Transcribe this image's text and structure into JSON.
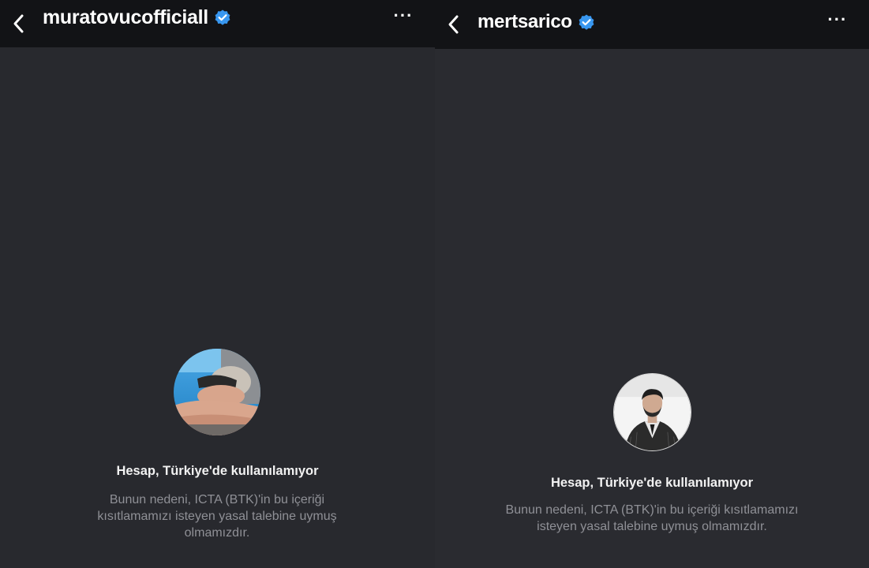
{
  "screens": [
    {
      "username": "muratovucofficiall",
      "verified": true,
      "avatar_description": "person-lying-in-pool-photo",
      "heading": "Hesap, Türkiye'de kullanılamıyor",
      "description_lines": [
        "Bunun nedeni, ICTA (BTK)'in bu içeriği",
        "kısıtlamamızı isteyen yasal talebine uymuş",
        "olmamızdır."
      ],
      "more_label": "···"
    },
    {
      "username": "mertsarico",
      "verified": true,
      "avatar_description": "man-in-pinstripe-suit-bw-photo",
      "heading": "Hesap, Türkiye'de kullanılamıyor",
      "description_lines": [
        "Bunun nedeni, ICTA (BTK)'in bu içeriği kısıtlamamızı",
        "isteyen yasal talebine uymuş olmamızdır."
      ],
      "more_label": "···"
    }
  ],
  "colors": {
    "verified_badge": "#3897f0",
    "topbar": "#121316",
    "background": "#28292e",
    "secondary_text": "#8f9096"
  }
}
